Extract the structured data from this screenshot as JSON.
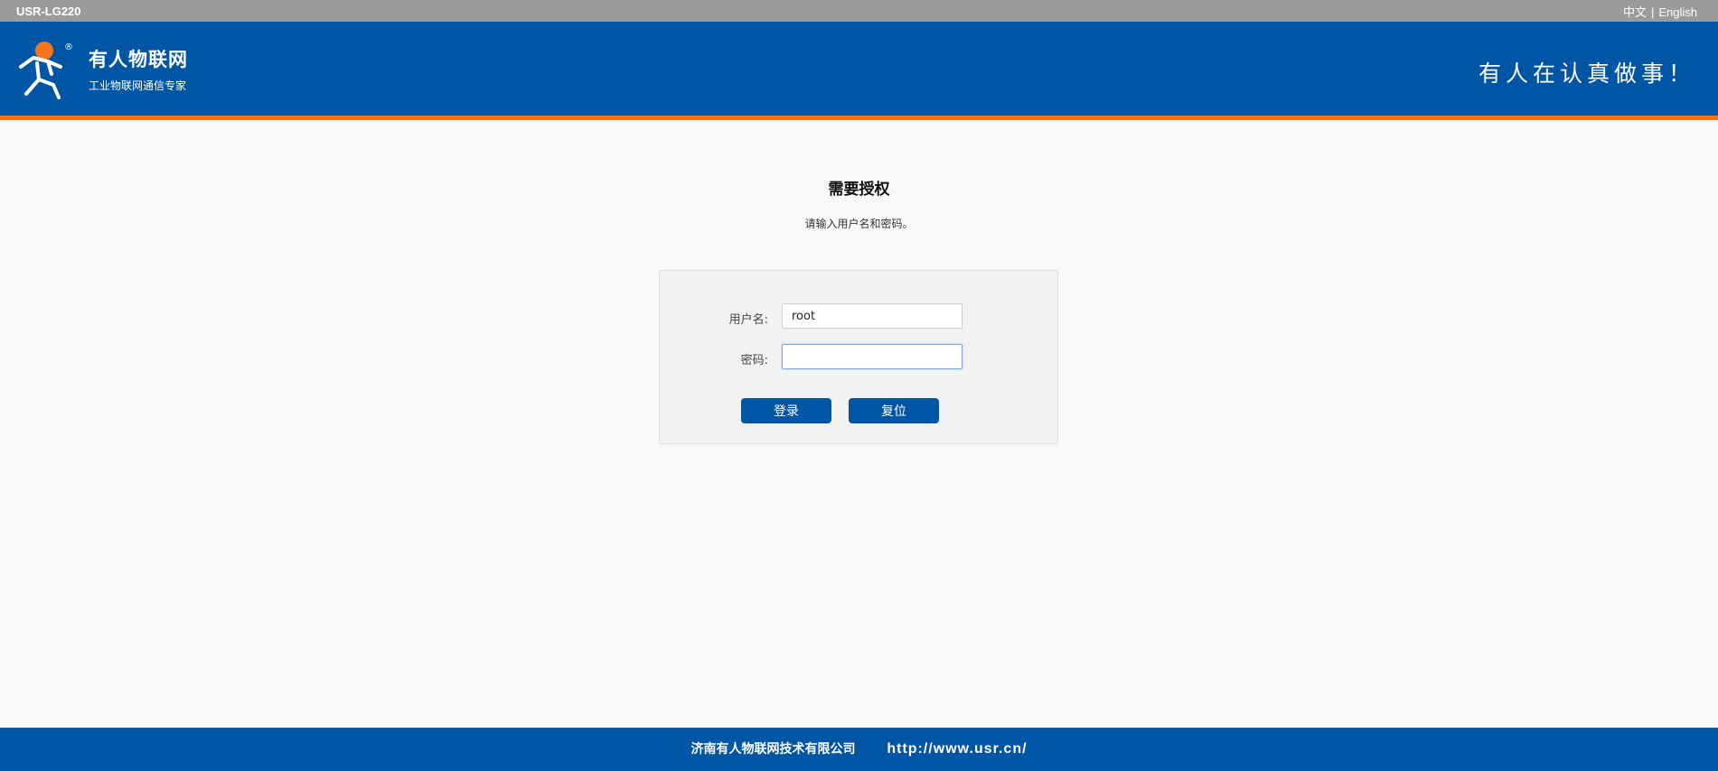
{
  "topbar": {
    "device_name": "USR-LG220",
    "lang_zh": "中文",
    "lang_separator": "|",
    "lang_en": "English"
  },
  "header": {
    "brand_name": "有人物联网",
    "brand_tagline": "工业物联网通信专家",
    "slogan": "有人在认真做事！",
    "logo_mark": "®"
  },
  "auth": {
    "title": "需要授权",
    "description": "请输入用户名和密码。"
  },
  "form": {
    "username_label": "用户名:",
    "username_value": "root",
    "password_label": "密码:",
    "password_value": "",
    "login_button": "登录",
    "reset_button": "复位"
  },
  "footer": {
    "company": "济南有人物联网技术有限公司",
    "url": "http://www.usr.cn/"
  },
  "colors": {
    "primary_blue": "#0155a5",
    "accent_orange": "#f2751c",
    "topbar_gray": "#9b9b9b"
  },
  "icons": {
    "logo": "running-person-logo-icon"
  }
}
